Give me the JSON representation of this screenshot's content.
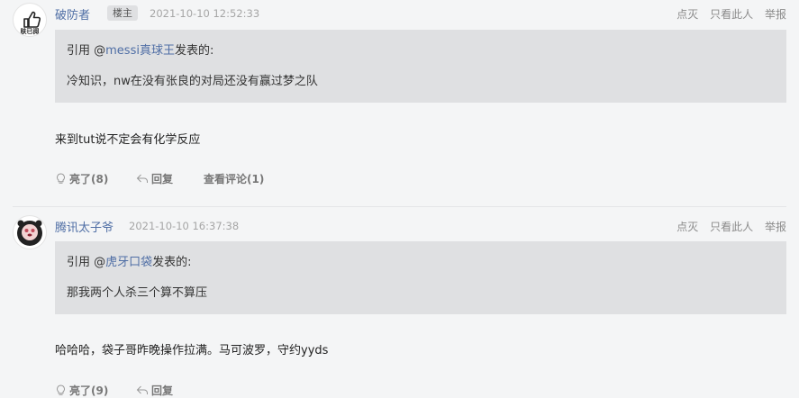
{
  "posts": [
    {
      "username": "破防者",
      "badge": "楼主",
      "time": "2021-10-10 12:52:33",
      "actions": [
        "点灭",
        "只看此人",
        "举报"
      ],
      "quote": {
        "prefix": "引用 @",
        "user": "messi真球王",
        "suffix": "发表的:",
        "text": "冷知识，nw在没有张良的对局还没有赢过梦之队"
      },
      "content": "来到tut说不定会有化学反应",
      "footer": {
        "like": "亮了(8)",
        "reply": "回复",
        "comments": "查看评论(1)"
      },
      "avatar_caption": "肤已阅"
    },
    {
      "username": "腾讯太子爷",
      "time": "2021-10-10 16:37:38",
      "actions": [
        "点灭",
        "只看此人",
        "举报"
      ],
      "quote": {
        "prefix": "引用 @",
        "user": "虎牙口袋",
        "suffix": "发表的:",
        "text": "那我两个人杀三个算不算压"
      },
      "content": "哈哈哈，袋子哥昨晚操作拉满。马可波罗，守约yyds",
      "footer": {
        "like": "亮了(9)",
        "reply": "回复"
      }
    }
  ]
}
